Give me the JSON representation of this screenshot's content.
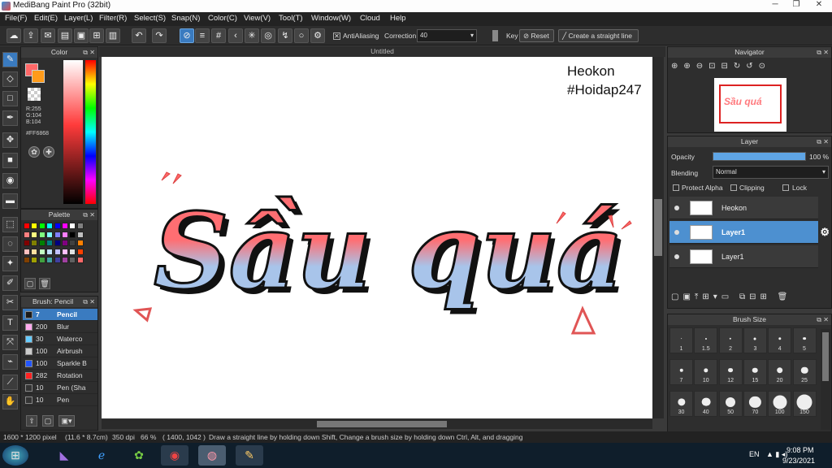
{
  "window": {
    "title": "MediBang Paint Pro (32bit)"
  },
  "menu": [
    "File(F)",
    "Edit(E)",
    "Layer(L)",
    "Filter(R)",
    "Select(S)",
    "Snap(N)",
    "Color(C)",
    "View(V)",
    "Tool(T)",
    "Window(W)",
    "Cloud",
    "Help"
  ],
  "toolbar": {
    "antialiasing": "AntiAliasing",
    "correction_label": "Correction",
    "correction_value": "40",
    "key_label": "Key",
    "reset_label": "Reset",
    "straight_line": "Create a straight line"
  },
  "document": {
    "tab": "Untitled",
    "author": "Heokon",
    "hashtag": "#Hoidap247",
    "artwork_text": "Sầu quá"
  },
  "color_panel": {
    "title": "Color",
    "r": "R:255",
    "g": "G:104",
    "b": "B:104",
    "hex": "#FF6868",
    "main": "#ff6868"
  },
  "palette_panel": {
    "title": "Palette",
    "colors": [
      "#ff0000",
      "#ffff00",
      "#00ff00",
      "#00ffff",
      "#0000ff",
      "#ff00ff",
      "#ffffff",
      "#808080",
      "#ff8080",
      "#ffff80",
      "#80ff80",
      "#80ffff",
      "#8080ff",
      "#ff80ff",
      "#000000",
      "#c0c0c0",
      "#800000",
      "#808000",
      "#008000",
      "#008080",
      "#000080",
      "#800080",
      "#404040",
      "#ff8000",
      "#ffc0c0",
      "#ffe0a0",
      "#c0ffc0",
      "#c0e0ff",
      "#c0c0ff",
      "#ffc0ff",
      "#e0e0e0",
      "#ff4000",
      "#804000",
      "#a0a000",
      "#40a040",
      "#40a0a0",
      "#4040a0",
      "#a040a0",
      "#606060",
      "#ff6868"
    ]
  },
  "brush_panel": {
    "title": "Brush: Pencil",
    "items": [
      {
        "size": "7",
        "name": "Pencil",
        "color": "#1a1a1a"
      },
      {
        "size": "200",
        "name": "Blur",
        "color": "#ffaaee"
      },
      {
        "size": "30",
        "name": "Waterco",
        "color": "#66ccff"
      },
      {
        "size": "100",
        "name": "Airbrush",
        "color": "#cccccc"
      },
      {
        "size": "100",
        "name": "Sparkle B",
        "color": "#2255ff"
      },
      {
        "size": "282",
        "name": "Rotation",
        "color": "#ff2222"
      },
      {
        "size": "10",
        "name": "Pen (Sha",
        "color": "#333333"
      },
      {
        "size": "10",
        "name": "Pen",
        "color": "#333333"
      }
    ]
  },
  "navigator": {
    "title": "Navigator"
  },
  "layer_panel": {
    "title": "Layer",
    "opacity_label": "Opacity",
    "opacity_value": "100 %",
    "opacity": 1.0,
    "blending_label": "Blending",
    "blending_value": "Normal",
    "protect_alpha": "Protect Alpha",
    "clipping": "Clipping",
    "lock": "Lock",
    "layers": [
      {
        "name": "Heokon",
        "selected": false
      },
      {
        "name": "Layer1",
        "selected": true
      },
      {
        "name": "Layer1",
        "selected": false
      }
    ]
  },
  "brush_size_panel": {
    "title": "Brush Size",
    "sizes": [
      "1",
      "1.5",
      "2",
      "3",
      "4",
      "5",
      "7",
      "10",
      "12",
      "15",
      "20",
      "25",
      "30",
      "40",
      "50",
      "70",
      "100",
      "150"
    ]
  },
  "status": {
    "dimensions": "1600 * 1200 pixel",
    "physical": "(11.6 * 8.7cm)",
    "dpi": "350 dpi",
    "zoom": "66 %",
    "coords": "( 1400, 1042 )",
    "hint": "Draw a straight line by holding down Shift, Change a brush size by holding down Ctrl, Alt, and dragging"
  },
  "taskbar": {
    "lang": "EN",
    "time": "9:08 PM",
    "date": "9/23/2021"
  },
  "colors": {
    "accent": "#3a7bc0",
    "brush_pink": "#ff6868",
    "brush_blue": "#a7c3e8"
  }
}
